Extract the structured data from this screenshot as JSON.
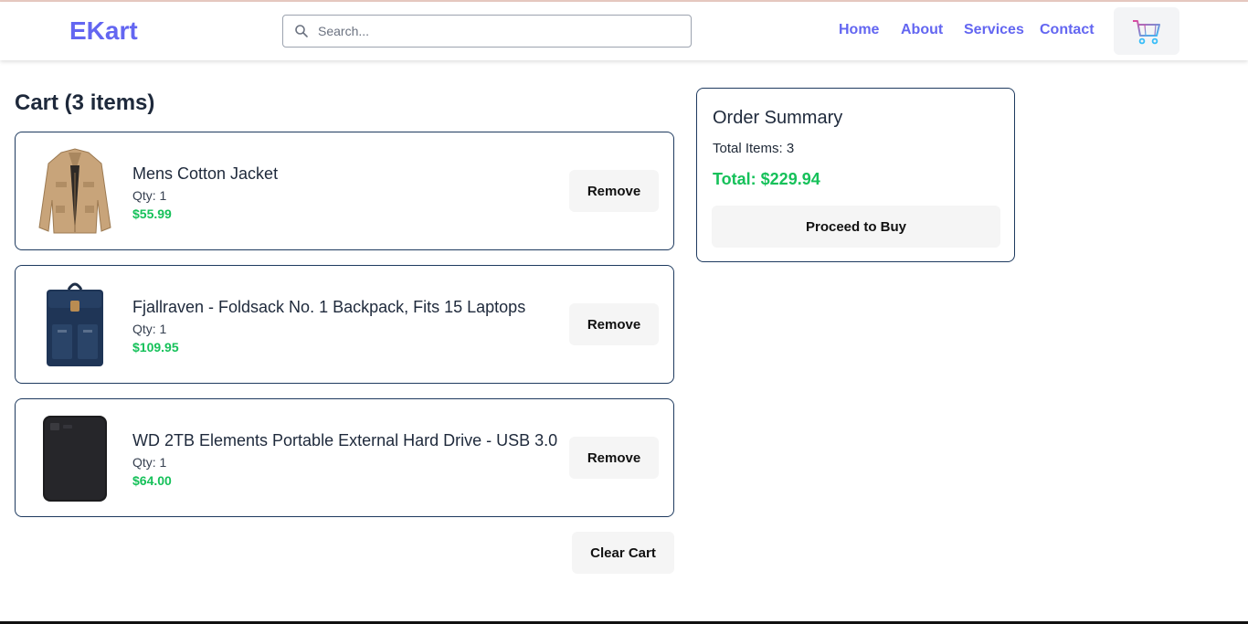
{
  "header": {
    "brand": "EKart",
    "search_placeholder": "Search...",
    "nav": [
      "Home",
      "About",
      "Services",
      "Contact"
    ],
    "cart_icon": "shopping-cart-icon"
  },
  "cart": {
    "title": "Cart (3 items)",
    "items": [
      {
        "name": "Mens Cotton Jacket",
        "qty": "Qty: 1",
        "price": "$55.99",
        "remove_label": "Remove",
        "image": "jacket-image"
      },
      {
        "name": "Fjallraven - Foldsack No. 1 Backpack, Fits 15 Laptops",
        "qty": "Qty: 1",
        "price": "$109.95",
        "remove_label": "Remove",
        "image": "backpack-image"
      },
      {
        "name": "WD 2TB Elements Portable External Hard Drive - USB 3.0",
        "qty": "Qty: 1",
        "price": "$64.00",
        "remove_label": "Remove",
        "image": "hard-drive-image"
      }
    ],
    "clear_label": "Clear Cart"
  },
  "summary": {
    "title": "Order Summary",
    "total_items": "Total Items: 3",
    "total": "Total: $229.94",
    "buy_label": "Proceed to Buy"
  },
  "colors": {
    "brand": "#6366f1",
    "price": "#16c15a",
    "border": "#1e3a5f",
    "button_bg": "#f5f5f5"
  }
}
